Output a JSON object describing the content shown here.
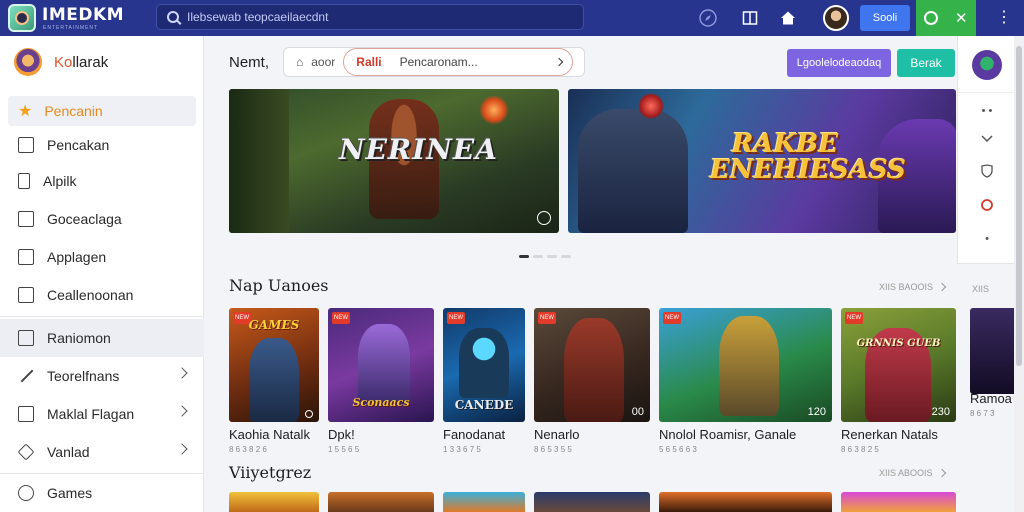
{
  "topbar": {
    "brand": "IMEDKM",
    "brand_sub": "ENTERTAINMENT",
    "search_placeholder": "Ilebsewab teopcaeilaecdnt",
    "btn_blue": "Sooli",
    "kebab": "⋮"
  },
  "sidebar": {
    "user_first": "Ko",
    "user_rest": "llarak",
    "items": [
      {
        "label": "Pencanin",
        "icon": "star-icon",
        "active": true
      },
      {
        "label": "Pencakan",
        "icon": "tag-icon"
      },
      {
        "label": "Alpilk",
        "icon": "bookmark-icon"
      },
      {
        "label": "Goceaclaga",
        "icon": "image-icon"
      },
      {
        "label": "Applagen",
        "icon": "box-icon"
      },
      {
        "label": "Ceallenoonan",
        "icon": "card-icon"
      },
      {
        "label": "Raniomon",
        "icon": "arrow-box-icon",
        "selected": true
      },
      {
        "label": "Teorelfnans",
        "icon": "pencil-icon",
        "chevron": true
      },
      {
        "label": "Maklal Flagan",
        "icon": "bag-icon",
        "chevron": true
      },
      {
        "label": "Vanlad",
        "icon": "diamond-icon",
        "chevron": true
      },
      {
        "label": "Games",
        "icon": "smile-icon"
      }
    ]
  },
  "header": {
    "title": "Nemt,",
    "filter_opt": "aoor",
    "chip_red": "Ralli",
    "chip_text": "Pencaronam...",
    "btn_purple": "Lgoolelodeaodaq",
    "btn_teal": "Berak"
  },
  "banners": [
    {
      "title": "NERINEA"
    },
    {
      "title": "RAKBE ENEHIESASS"
    }
  ],
  "section1": {
    "title": "Nap Uanoes",
    "more": "XIIS BAOOIS",
    "cards": [
      {
        "title": "GAMES",
        "name": "Kaohia Natalk",
        "meta": "8 6 3 8 2 6",
        "num": "",
        "tag": "NEW"
      },
      {
        "title": "Sconaacs",
        "name": "Dpk!",
        "meta": "1 5 5 6 5",
        "num": "",
        "tag": "NEW"
      },
      {
        "title": "CANEDE",
        "name": "Fanodanat",
        "meta": "1 3 3 6 7 5",
        "num": "",
        "tag": "NEW"
      },
      {
        "title": "",
        "name": "Nenarlo",
        "meta": "8 6 5 3 5 5",
        "num": "00",
        "tag": "NEW"
      },
      {
        "title": "",
        "name": "Nnolol Roamisr, Ganale",
        "meta": "5 6 5 6 6 3",
        "num": "120",
        "tag": "NEW"
      },
      {
        "title": "GRNNIS GUEB",
        "name": "Renerkan Natals",
        "meta": "8 6 3 8 2 5",
        "num": "230",
        "tag": "NEW"
      },
      {
        "title": "",
        "name": "Ramoa",
        "meta": "8 6 7 3",
        "num": "",
        "tag": ""
      }
    ]
  },
  "section2": {
    "title": "Viiyetgrez",
    "more": "XIIS ABOOIS"
  },
  "right_panel_more": "XIIS"
}
